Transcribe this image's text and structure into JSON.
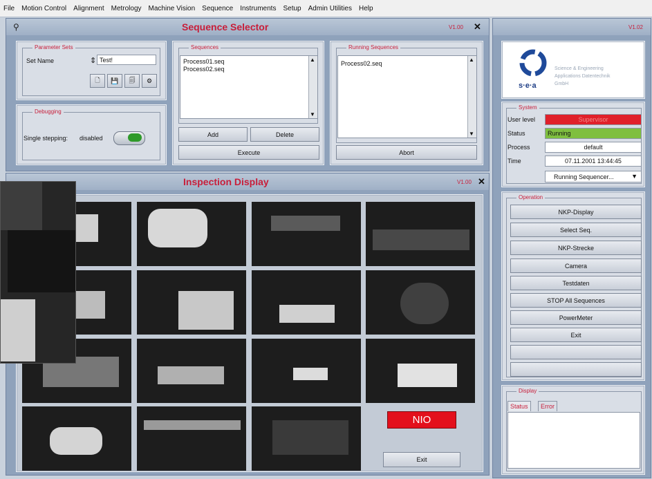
{
  "menu": [
    "File",
    "Motion Control",
    "Alignment",
    "Metrology",
    "Machine Vision",
    "Sequence",
    "Instruments",
    "Setup",
    "Admin Utilities",
    "Help"
  ],
  "seq_window": {
    "title": "Sequence Selector",
    "version": "V1.00",
    "close": "✕",
    "param_sets": {
      "label": "Parameter Sets",
      "set_name_label": "Set Name",
      "set_name_value": "Test!"
    },
    "debugging": {
      "label": "Debugging",
      "single_stepping_label": "Single stepping:",
      "single_stepping_value": "disabled"
    },
    "sequences": {
      "label": "Sequences",
      "items": [
        "Process01.seq",
        "Process02.seq"
      ],
      "add": "Add",
      "delete": "Delete",
      "execute": "Execute"
    },
    "running": {
      "label": "Running Sequences",
      "items": [
        "Process02.seq"
      ],
      "abort": "Abort"
    }
  },
  "right_window": {
    "version": "V1.02",
    "logo": {
      "mark": "s·e·a",
      "line1": "Science & Engineering",
      "line2": "Applications Datentechnik",
      "line3": "GmbH"
    },
    "system": {
      "label": "System",
      "user_level_label": "User level",
      "user_level_value": "Supervisor",
      "status_label": "Status",
      "status_value": "Running",
      "process_label": "Process",
      "process_value": "default",
      "time_label": "Time",
      "time_value": "07.11.2001 13:44:45",
      "dropdown": "Running Sequencer..."
    },
    "operation": {
      "label": "Operation",
      "buttons": [
        "NKP-Display",
        "Select Seq.",
        "NKP-Strecke",
        "Camera",
        "Testdaten",
        "STOP All Sequences",
        "PowerMeter",
        "Exit",
        "",
        ""
      ]
    },
    "display": {
      "label": "Display",
      "tabs": [
        "Status",
        "Error"
      ]
    }
  },
  "inspection": {
    "title": "Inspection Display",
    "version": "V1.00",
    "close": "✕",
    "result": "NIO",
    "exit": "Exit"
  },
  "colors": {
    "accent": "#c81e3a",
    "user_level_bg": "#e0202a",
    "status_bg": "#7fbf3f",
    "nio_bg": "#e3101c"
  }
}
